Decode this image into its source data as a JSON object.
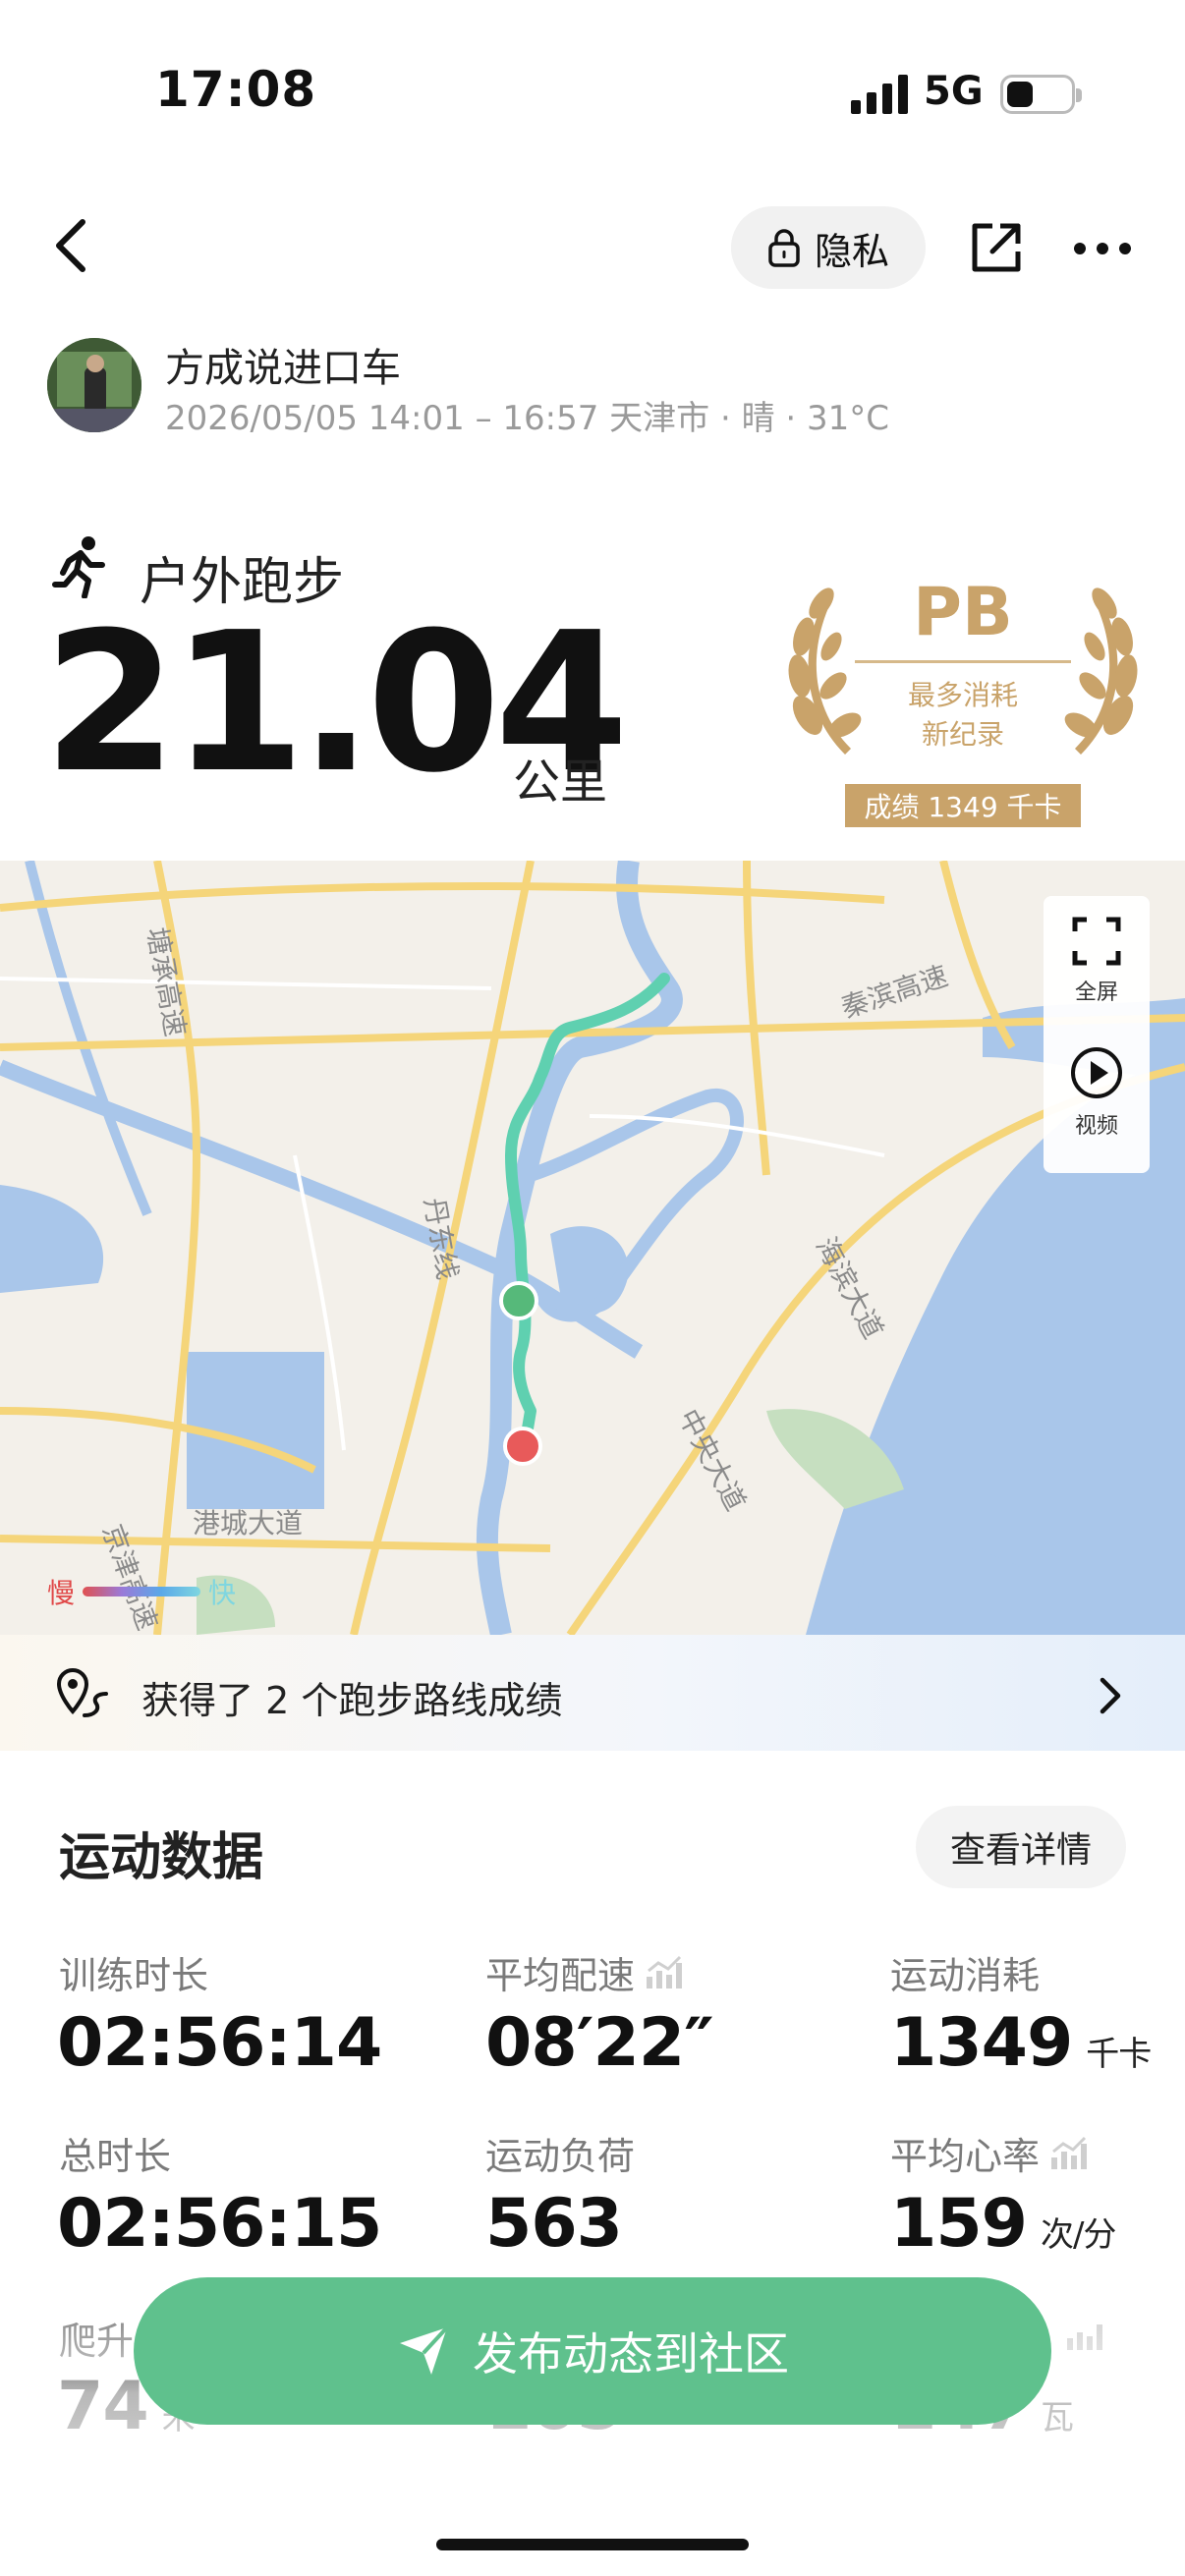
{
  "status_bar": {
    "time": "17:08",
    "network": "5G",
    "battery_level": 0.3
  },
  "nav": {
    "privacy_label": "隐私"
  },
  "user": {
    "name": "方成说进口车",
    "meta": "2026/05/05 14:01 – 16:57 天津市 · 晴 · 31°C"
  },
  "activity": {
    "type": "户外跑步",
    "distance": "21.04",
    "distance_unit": "公里"
  },
  "pb": {
    "title": "PB",
    "line1": "最多消耗",
    "line2": "新纪录",
    "score": "成绩 1349 千卡"
  },
  "map": {
    "labels": {
      "tangcheng": "塘承高速",
      "qinbin": "秦滨高速",
      "dandong": "丹东线",
      "haibin": "海滨大道",
      "zhongyang": "中央大道",
      "gangcheng": "港城大道",
      "jingjin": "京津高速"
    },
    "controls": {
      "fullscreen": "全屏",
      "video": "视频"
    },
    "legend_slow": "慢",
    "legend_fast": "快"
  },
  "banner": {
    "text": "获得了 2 个跑步路线成绩"
  },
  "stats": {
    "title": "运动数据",
    "detail_label": "查看详情",
    "items": [
      {
        "label": "训练时长",
        "value": "02:56:14",
        "unit": ""
      },
      {
        "label": "平均配速",
        "value": "08′22″",
        "unit": ""
      },
      {
        "label": "运动消耗",
        "value": "1349",
        "unit": "千卡"
      },
      {
        "label": "总时长",
        "value": "02:56:15",
        "unit": ""
      },
      {
        "label": "运动负荷",
        "value": "563",
        "unit": ""
      },
      {
        "label": "平均心率",
        "value": "159",
        "unit": "次/分"
      },
      {
        "label": "爬升",
        "value": "74",
        "unit": "米"
      },
      {
        "label": "",
        "value": "105",
        "unit": ""
      },
      {
        "label": "",
        "value": "147",
        "unit": "瓦"
      }
    ]
  },
  "publish": {
    "label": "发布动态到社区"
  },
  "colors": {
    "accent": "#5fc18d",
    "gold": "#c9a36a",
    "route": "#5fd0b0"
  }
}
